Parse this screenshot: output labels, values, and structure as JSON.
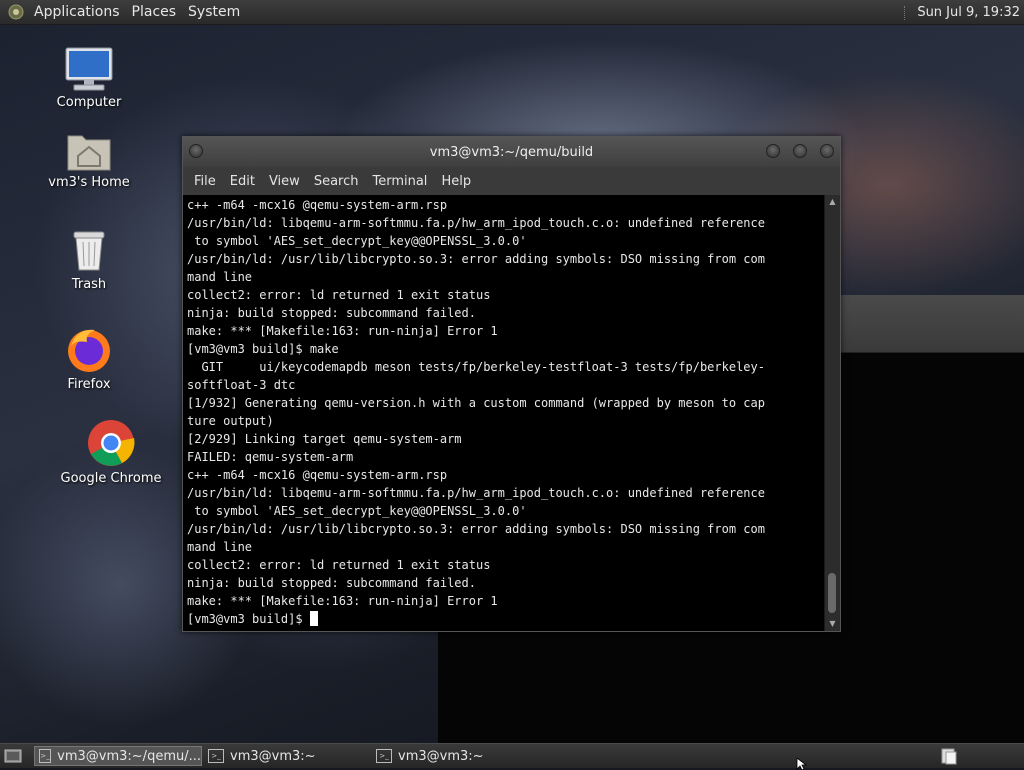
{
  "top_panel": {
    "menus": [
      "Applications",
      "Places",
      "System"
    ],
    "clock": "Sun Jul  9, 19:32"
  },
  "desktop_icons": [
    {
      "label": "Computer",
      "icon": "computer-icon"
    },
    {
      "label": "vm3's Home",
      "icon": "home-folder-icon"
    },
    {
      "label": "Trash",
      "icon": "trash-icon"
    },
    {
      "label": "Firefox",
      "icon": "firefox-icon"
    },
    {
      "label": "Google Chrome",
      "icon": "chrome-icon"
    }
  ],
  "terminal": {
    "title": "vm3@vm3:~/qemu/build",
    "menu": [
      "File",
      "Edit",
      "View",
      "Search",
      "Terminal",
      "Help"
    ],
    "lines": [
      "c++ -m64 -mcx16 @qemu-system-arm.rsp",
      "/usr/bin/ld: libqemu-arm-softmmu.fa.p/hw_arm_ipod_touch.c.o: undefined reference",
      " to symbol 'AES_set_decrypt_key@@OPENSSL_3.0.0'",
      "/usr/bin/ld: /usr/lib/libcrypto.so.3: error adding symbols: DSO missing from com",
      "mand line",
      "collect2: error: ld returned 1 exit status",
      "ninja: build stopped: subcommand failed.",
      "make: *** [Makefile:163: run-ninja] Error 1",
      "[vm3@vm3 build]$ make",
      "  GIT     ui/keycodemapdb meson tests/fp/berkeley-testfloat-3 tests/fp/berkeley-",
      "softfloat-3 dtc",
      "[1/932] Generating qemu-version.h with a custom command (wrapped by meson to cap",
      "ture output)",
      "[2/929] Linking target qemu-system-arm",
      "FAILED: qemu-system-arm",
      "c++ -m64 -mcx16 @qemu-system-arm.rsp",
      "/usr/bin/ld: libqemu-arm-softmmu.fa.p/hw_arm_ipod_touch.c.o: undefined reference",
      " to symbol 'AES_set_decrypt_key@@OPENSSL_3.0.0'",
      "/usr/bin/ld: /usr/lib/libcrypto.so.3: error adding symbols: DSO missing from com",
      "mand line",
      "collect2: error: ld returned 1 exit status",
      "ninja: build stopped: subcommand failed.",
      "make: *** [Makefile:163: run-ninja] Error 1"
    ],
    "prompt": "[vm3@vm3 build]$ "
  },
  "taskbar": {
    "tasks": [
      {
        "label": "vm3@vm3:~/qemu/...",
        "active": true
      },
      {
        "label": "vm3@vm3:~",
        "active": false
      },
      {
        "label": "vm3@vm3:~",
        "active": false
      }
    ]
  },
  "colors": {
    "panel": "#2e2e2e",
    "terminal_bg": "#000000",
    "terminal_fg": "#e8e8e8"
  }
}
